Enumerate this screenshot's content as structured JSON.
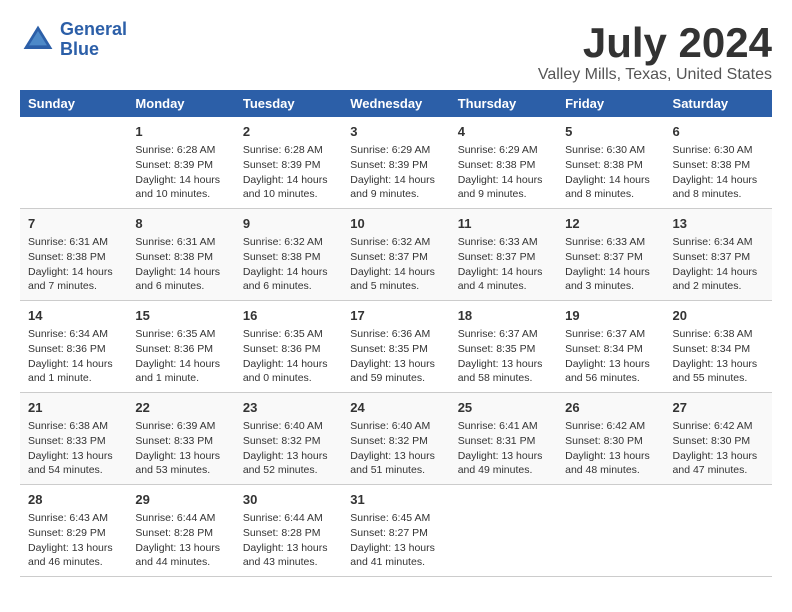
{
  "header": {
    "logo_line1": "General",
    "logo_line2": "Blue",
    "month_title": "July 2024",
    "location": "Valley Mills, Texas, United States"
  },
  "weekdays": [
    "Sunday",
    "Monday",
    "Tuesday",
    "Wednesday",
    "Thursday",
    "Friday",
    "Saturday"
  ],
  "weeks": [
    [
      {
        "day": "",
        "info": ""
      },
      {
        "day": "1",
        "info": "Sunrise: 6:28 AM\nSunset: 8:39 PM\nDaylight: 14 hours and 10 minutes."
      },
      {
        "day": "2",
        "info": "Sunrise: 6:28 AM\nSunset: 8:39 PM\nDaylight: 14 hours and 10 minutes."
      },
      {
        "day": "3",
        "info": "Sunrise: 6:29 AM\nSunset: 8:39 PM\nDaylight: 14 hours and 9 minutes."
      },
      {
        "day": "4",
        "info": "Sunrise: 6:29 AM\nSunset: 8:38 PM\nDaylight: 14 hours and 9 minutes."
      },
      {
        "day": "5",
        "info": "Sunrise: 6:30 AM\nSunset: 8:38 PM\nDaylight: 14 hours and 8 minutes."
      },
      {
        "day": "6",
        "info": "Sunrise: 6:30 AM\nSunset: 8:38 PM\nDaylight: 14 hours and 8 minutes."
      }
    ],
    [
      {
        "day": "7",
        "info": "Sunrise: 6:31 AM\nSunset: 8:38 PM\nDaylight: 14 hours and 7 minutes."
      },
      {
        "day": "8",
        "info": "Sunrise: 6:31 AM\nSunset: 8:38 PM\nDaylight: 14 hours and 6 minutes."
      },
      {
        "day": "9",
        "info": "Sunrise: 6:32 AM\nSunset: 8:38 PM\nDaylight: 14 hours and 6 minutes."
      },
      {
        "day": "10",
        "info": "Sunrise: 6:32 AM\nSunset: 8:37 PM\nDaylight: 14 hours and 5 minutes."
      },
      {
        "day": "11",
        "info": "Sunrise: 6:33 AM\nSunset: 8:37 PM\nDaylight: 14 hours and 4 minutes."
      },
      {
        "day": "12",
        "info": "Sunrise: 6:33 AM\nSunset: 8:37 PM\nDaylight: 14 hours and 3 minutes."
      },
      {
        "day": "13",
        "info": "Sunrise: 6:34 AM\nSunset: 8:37 PM\nDaylight: 14 hours and 2 minutes."
      }
    ],
    [
      {
        "day": "14",
        "info": "Sunrise: 6:34 AM\nSunset: 8:36 PM\nDaylight: 14 hours and 1 minute."
      },
      {
        "day": "15",
        "info": "Sunrise: 6:35 AM\nSunset: 8:36 PM\nDaylight: 14 hours and 1 minute."
      },
      {
        "day": "16",
        "info": "Sunrise: 6:35 AM\nSunset: 8:36 PM\nDaylight: 14 hours and 0 minutes."
      },
      {
        "day": "17",
        "info": "Sunrise: 6:36 AM\nSunset: 8:35 PM\nDaylight: 13 hours and 59 minutes."
      },
      {
        "day": "18",
        "info": "Sunrise: 6:37 AM\nSunset: 8:35 PM\nDaylight: 13 hours and 58 minutes."
      },
      {
        "day": "19",
        "info": "Sunrise: 6:37 AM\nSunset: 8:34 PM\nDaylight: 13 hours and 56 minutes."
      },
      {
        "day": "20",
        "info": "Sunrise: 6:38 AM\nSunset: 8:34 PM\nDaylight: 13 hours and 55 minutes."
      }
    ],
    [
      {
        "day": "21",
        "info": "Sunrise: 6:38 AM\nSunset: 8:33 PM\nDaylight: 13 hours and 54 minutes."
      },
      {
        "day": "22",
        "info": "Sunrise: 6:39 AM\nSunset: 8:33 PM\nDaylight: 13 hours and 53 minutes."
      },
      {
        "day": "23",
        "info": "Sunrise: 6:40 AM\nSunset: 8:32 PM\nDaylight: 13 hours and 52 minutes."
      },
      {
        "day": "24",
        "info": "Sunrise: 6:40 AM\nSunset: 8:32 PM\nDaylight: 13 hours and 51 minutes."
      },
      {
        "day": "25",
        "info": "Sunrise: 6:41 AM\nSunset: 8:31 PM\nDaylight: 13 hours and 49 minutes."
      },
      {
        "day": "26",
        "info": "Sunrise: 6:42 AM\nSunset: 8:30 PM\nDaylight: 13 hours and 48 minutes."
      },
      {
        "day": "27",
        "info": "Sunrise: 6:42 AM\nSunset: 8:30 PM\nDaylight: 13 hours and 47 minutes."
      }
    ],
    [
      {
        "day": "28",
        "info": "Sunrise: 6:43 AM\nSunset: 8:29 PM\nDaylight: 13 hours and 46 minutes."
      },
      {
        "day": "29",
        "info": "Sunrise: 6:44 AM\nSunset: 8:28 PM\nDaylight: 13 hours and 44 minutes."
      },
      {
        "day": "30",
        "info": "Sunrise: 6:44 AM\nSunset: 8:28 PM\nDaylight: 13 hours and 43 minutes."
      },
      {
        "day": "31",
        "info": "Sunrise: 6:45 AM\nSunset: 8:27 PM\nDaylight: 13 hours and 41 minutes."
      },
      {
        "day": "",
        "info": ""
      },
      {
        "day": "",
        "info": ""
      },
      {
        "day": "",
        "info": ""
      }
    ]
  ]
}
